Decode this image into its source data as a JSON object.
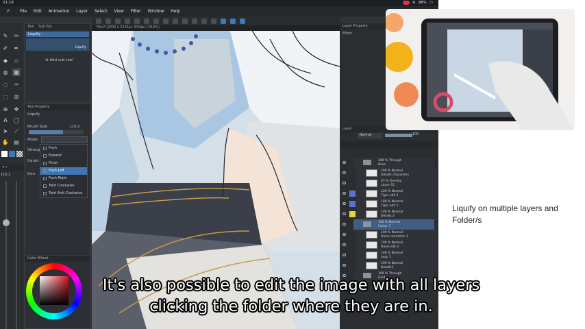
{
  "status_bar": {
    "time": "21:18",
    "battery": "98%"
  },
  "menu": {
    "items": [
      "File",
      "Edit",
      "Animation",
      "Layer",
      "Select",
      "View",
      "Filter",
      "Window",
      "Help"
    ]
  },
  "subtool_panel": {
    "tab_tool": "Tool",
    "tab_subtool": "Sub Too",
    "selected": "Liquify",
    "row_label": "Liquify",
    "add_label": "Add sub tool"
  },
  "tool_property": {
    "title": "Tool Property",
    "tool_name": "Liquify",
    "brush_size_label": "Brush Size",
    "brush_size_value": "116.2",
    "mode_label": "Mode",
    "strength_label": "Streng",
    "hardness_label": "Hardn",
    "density_label": "Den",
    "left_value": "116.2"
  },
  "mode_dropdown": {
    "items": [
      "Push",
      "Expand",
      "Pinch",
      "Push Left",
      "Push Right",
      "Twirl Clockwise",
      "Twirl Anti-Clockwise"
    ],
    "selected": "Push Left"
  },
  "canvas": {
    "title": "*Dwi* (2500 x 3226px 300dpi 178.8%)"
  },
  "layer_property": {
    "tab": "Layer Property",
    "effect_label": "Effect"
  },
  "color_wheel": {
    "title": "Color Wheel"
  },
  "layer_panel": {
    "title": "Layer",
    "blend_mode": "Normal",
    "opacity": "100",
    "layers": [
      {
        "line1": "100 % Through",
        "line2": "Base",
        "type": "folder",
        "swatch": "",
        "selected": false
      },
      {
        "line1": "100 % Normal",
        "line2": "Details characters",
        "type": "layer",
        "swatch": "",
        "selected": false
      },
      {
        "line1": "37 % Overlay",
        "line2": "Layer 65",
        "type": "layer",
        "swatch": "",
        "selected": false
      },
      {
        "line1": "100 % Normal",
        "line2": "Tiger edit 1",
        "type": "layer",
        "swatch": "#5f6fd6",
        "selected": false
      },
      {
        "line1": "100 % Normal",
        "line2": "Tiger edit 2",
        "type": "layer",
        "swatch": "#5f6fd6",
        "selected": false
      },
      {
        "line1": "100 % Normal",
        "line2": "Details 2",
        "type": "layer",
        "swatch": "#e3d53a",
        "selected": false
      },
      {
        "line1": "100 % Normal",
        "line2": "Folder 7",
        "type": "folder",
        "swatch": "",
        "selected": true
      },
      {
        "line1": "100 % Normal",
        "line2": "Hand correction 1",
        "type": "layer",
        "swatch": "",
        "selected": false
      },
      {
        "line1": "100 % Normal",
        "line2": "Hand edit 2",
        "type": "layer",
        "swatch": "",
        "selected": false
      },
      {
        "line1": "100 % Normal",
        "line2": "Legs 1",
        "type": "layer",
        "swatch": "",
        "selected": false
      },
      {
        "line1": "100 % Normal",
        "line2": "Details1",
        "type": "layer",
        "swatch": "",
        "selected": false
      },
      {
        "line1": "100 % Through",
        "line2": "Gold",
        "type": "folder",
        "swatch": "",
        "selected": false
      }
    ]
  },
  "annotation": {
    "caption": "Liquify on multiple layers and Folder/s"
  },
  "subtitles": {
    "line1": "It's also possible to edit the image with all layers",
    "line2": "clicking the folder where they are in."
  },
  "colors": {
    "app_bg": "#2f3236",
    "accent": "#3f76b3",
    "layer_swatch_blue": "#5f6fd6",
    "layer_swatch_yellow": "#e3d53a"
  }
}
